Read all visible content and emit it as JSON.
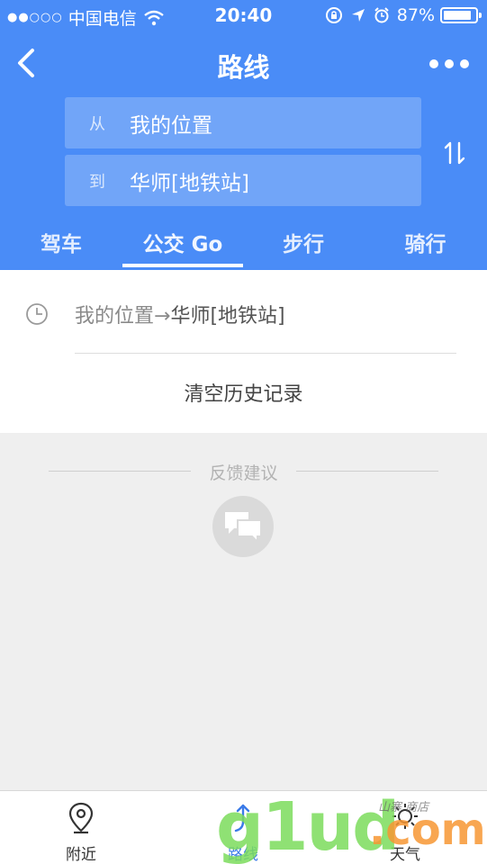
{
  "status_bar": {
    "signal": "●●○○○",
    "carrier": "中国电信",
    "time": "20:40",
    "battery": "87%",
    "battery_level": 0.87
  },
  "nav": {
    "title": "路线"
  },
  "route_inputs": {
    "from_label": "从",
    "from_value": "我的位置",
    "to_label": "到",
    "to_value": "华师[地铁站]"
  },
  "mode_tabs": [
    {
      "label": "驾车"
    },
    {
      "label": "公交 Go"
    },
    {
      "label": "步行"
    },
    {
      "label": "骑行"
    }
  ],
  "active_mode": 1,
  "history": {
    "item_origin": "我的位置→",
    "item_destination": "华师[地铁站]",
    "clear_label": "清空历史记录"
  },
  "feedback": {
    "title": "反馈建议"
  },
  "tabbar": [
    {
      "label": "附近",
      "icon": "location-pin-icon"
    },
    {
      "label": "路线",
      "icon": "route-icon"
    },
    {
      "label": "天气",
      "icon": "sun-icon"
    }
  ],
  "watermark": {
    "brand_green": "g1ud",
    "brand_orange": ".com",
    "small": "山寨 商店"
  },
  "colors": {
    "header": "#4a8cf7",
    "active_tab": "#3b7be8"
  }
}
